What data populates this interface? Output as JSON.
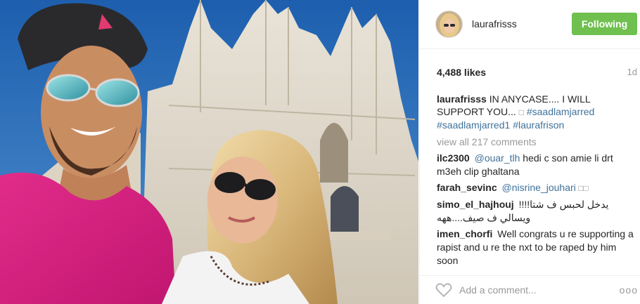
{
  "post": {
    "image_description_icon": "selfie-photo",
    "username": "laurafrisss",
    "follow_label": "Following",
    "likes": "4,488 likes",
    "age": "1d"
  },
  "caption": {
    "username": "laurafrisss",
    "text": " IN ANYCASE.... I WILL SUPPORT YOU... ",
    "glyph": "□",
    "tag1": "#saadlamjarred",
    "tag2": "#saadlamjarred1",
    "tag3": "#laurafrison"
  },
  "view_all": "view all 217 comments",
  "comments": [
    {
      "username": "ilc2300",
      "mention": "@ouar_tlh",
      "text": " hedi c son amie li drt m3eh clip ghaltana"
    },
    {
      "username": "farah_sevinc",
      "mention": "@nisrine_jouhari",
      "text": " □□"
    },
    {
      "username": "simo_el_hajhouj",
      "mention": "",
      "text": "يدخل لحبس ف شتا!!!!ويسالي ف صيف....ههه"
    },
    {
      "username": "imen_chorfi",
      "mention": "",
      "text": " Well congrats u re supporting a rapist and u re the nxt to be raped by him soon"
    }
  ],
  "footer": {
    "add_comment_placeholder": "Add a comment...",
    "more_label": "ooo"
  },
  "colors": {
    "follow_green": "#70c050",
    "link_blue": "#3f729b",
    "muted_gray": "#999999"
  }
}
